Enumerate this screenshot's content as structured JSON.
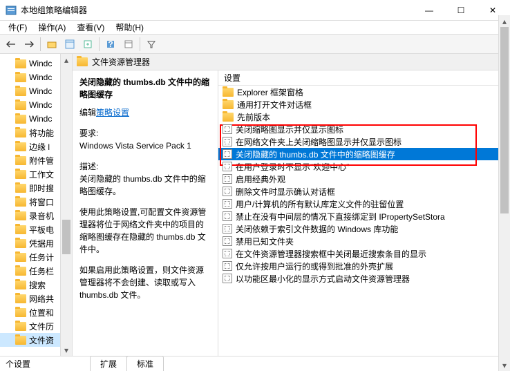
{
  "window": {
    "title": "本地组策略编辑器",
    "min": "—",
    "max": "☐",
    "close": "✕"
  },
  "menu": {
    "file": "件(F)",
    "action": "操作(A)",
    "view": "查看(V)",
    "help": "帮助(H)"
  },
  "path_header": "文件资源管理器",
  "detail": {
    "title": "关闭隐藏的 thumbs.db 文件中的缩略图缓存",
    "edit_prefix": "编辑",
    "edit_link": "策略设置",
    "req_label": "要求:",
    "req_value": "Windows Vista Service Pack 1",
    "desc_label": "描述:",
    "desc1": "关闭隐藏的 thumbs.db 文件中的缩略图缓存。",
    "desc2": "使用此策略设置,可配置文件资源管理器将位于网络文件夹中的项目的缩略图缓存在隐藏的 thumbs.db 文件中。",
    "desc3": "如果启用此策略设置，则文件资源管理器将不会创建、读取或写入 thumbs.db 文件。"
  },
  "list_header": "设置",
  "tree": [
    "Windc",
    "Windc",
    "Windc",
    "Windc",
    "Windc",
    "将功能",
    "边缘 l",
    "附件管",
    "工作文",
    "即时搜",
    "将窗口",
    "录音机",
    "平板电",
    "凭据用",
    "任务计",
    "任务栏",
    "搜索",
    "网络共",
    "位置和",
    "文件历",
    "文件资"
  ],
  "list": [
    {
      "t": "folder",
      "label": "Explorer 框架窗格"
    },
    {
      "t": "folder",
      "label": "通用打开文件对话框"
    },
    {
      "t": "folder",
      "label": "先前版本"
    },
    {
      "t": "policy",
      "label": "关闭缩略图显示并仅显示图标"
    },
    {
      "t": "policy",
      "label": "在网络文件夹上关闭缩略图显示并仅显示图标"
    },
    {
      "t": "policy",
      "label": "关闭隐藏的 thumbs.db 文件中的缩略图缓存",
      "sel": true
    },
    {
      "t": "policy",
      "label": "在用户登录时不显示\"欢迎中心\""
    },
    {
      "t": "policy",
      "label": "启用经典外观"
    },
    {
      "t": "policy",
      "label": "删除文件时显示确认对话框"
    },
    {
      "t": "policy",
      "label": "用户/计算机的所有默认库定义文件的驻留位置"
    },
    {
      "t": "policy",
      "label": "禁止在没有中间层的情况下直接绑定到 IPropertySetStora"
    },
    {
      "t": "policy",
      "label": "关闭依赖于索引文件数据的 Windows 库功能"
    },
    {
      "t": "policy",
      "label": "禁用已知文件夹"
    },
    {
      "t": "policy",
      "label": "在文件资源管理器搜索框中关闭最近搜索条目的显示"
    },
    {
      "t": "policy",
      "label": "仅允许按用户运行的或得到批准的外壳扩展"
    },
    {
      "t": "policy",
      "label": "以功能区最小化的显示方式启动文件资源管理器"
    }
  ],
  "tabs": {
    "ext": "扩展",
    "std": "标准"
  },
  "status": "个设置"
}
